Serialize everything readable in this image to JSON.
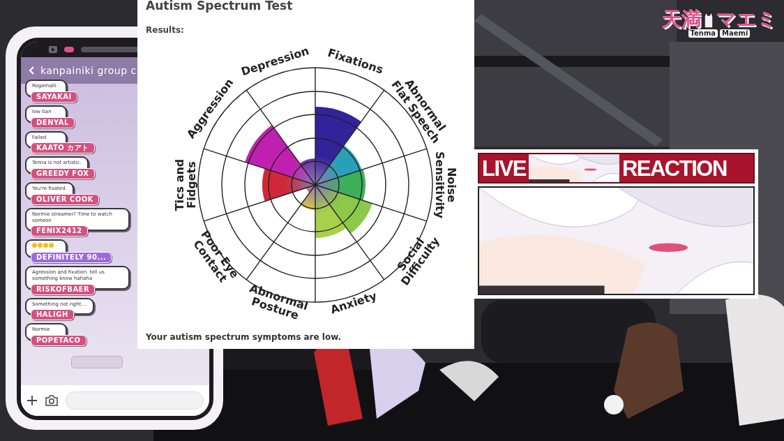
{
  "phone": {
    "title": "kanpainiki group c",
    "messages": [
      {
        "kind": "text",
        "text": "Rogemalli",
        "name": "SAYAKAI",
        "color": "#d64f7e"
      },
      {
        "kind": "text",
        "text": "low tian",
        "name": "DENYAL",
        "color": "#d64f7e"
      },
      {
        "kind": "text",
        "text": "Failed",
        "name": "KAATO カアト",
        "color": "#d64f7e"
      },
      {
        "kind": "text",
        "text": "Tenna is not artistic.",
        "name": "GREEDY FOX",
        "color": "#d64f7e"
      },
      {
        "kind": "text",
        "text": "You're fixated.",
        "name": "OLIVER COOK",
        "color": "#d64f7e"
      },
      {
        "kind": "text",
        "text": "Normie streamer? Time to watch someon",
        "name": "FENIX2412",
        "color": "#d64f7e"
      },
      {
        "kind": "emoji",
        "name": "DEFINITELY 90...",
        "color": "#9a6be0"
      },
      {
        "kind": "text",
        "text": "Agression and fixation. tell us something know hahaha",
        "name": "RISKOFBAER",
        "color": "#d64f7e"
      },
      {
        "kind": "text",
        "text": "Something not right....",
        "name": "HALIGH",
        "color": "#d64f7e"
      },
      {
        "kind": "text",
        "text": "Normie",
        "name": "POPETACO",
        "color": "#d64f7e"
      },
      {
        "kind": "faded"
      }
    ]
  },
  "test": {
    "title": "Autism Spectrum Test",
    "subtitle": "Results:",
    "axes": [
      {
        "lines": [
          "Fixations"
        ]
      },
      {
        "lines": [
          "Abnormal",
          "Flat Speech"
        ]
      },
      {
        "lines": [
          "Noise",
          "Sensitivity"
        ]
      },
      {
        "lines": [
          "Social",
          "Difficulty"
        ]
      },
      {
        "lines": [
          "Anxiety"
        ]
      },
      {
        "lines": [
          "Abnormal",
          "Posture"
        ]
      },
      {
        "lines": [
          "Poor Eye",
          "Contact"
        ]
      },
      {
        "lines": [
          "Tics and",
          "Fidgets"
        ]
      },
      {
        "lines": [
          "Aggression"
        ]
      },
      {
        "lines": [
          "Depression"
        ]
      }
    ],
    "summary": "Your autism spectrum symptoms are low."
  },
  "logo": {
    "kanji": "天満",
    "kana": "マエミ",
    "romaji": [
      "Tenma",
      "Maemi"
    ]
  },
  "reaction": {
    "left": "LIVE",
    "right": "REACTION"
  }
}
